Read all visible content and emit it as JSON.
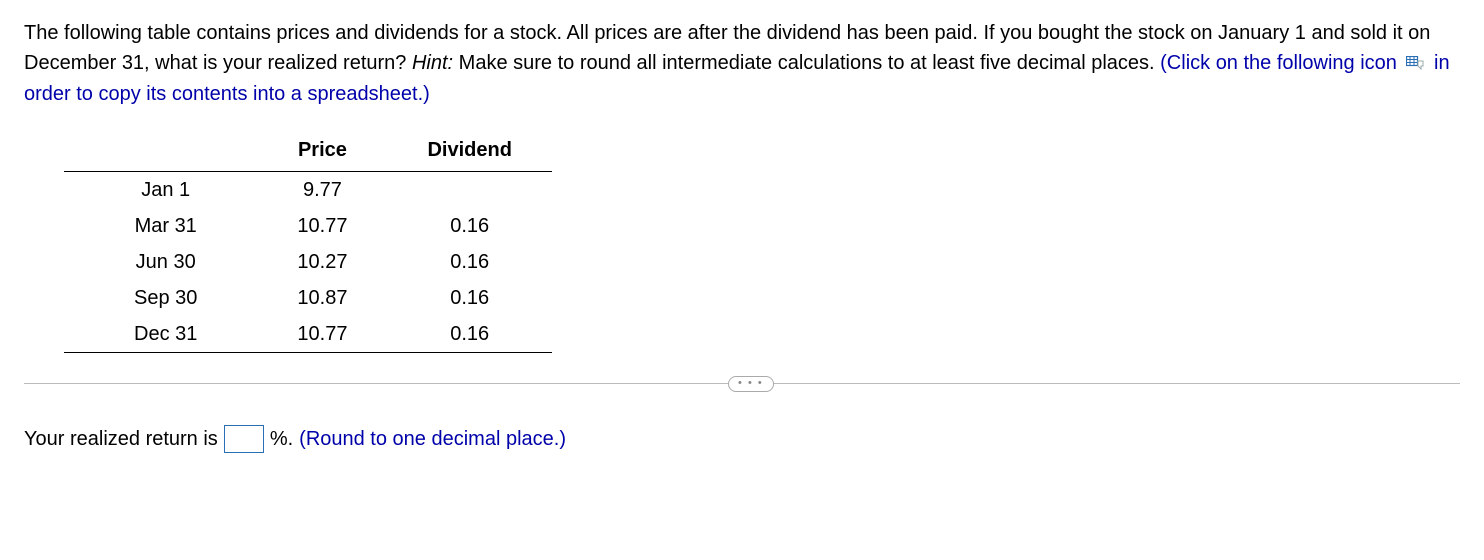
{
  "question": {
    "intro": "The following table contains prices and dividends for a stock. All prices are after the dividend has been paid. If you bought the stock on January 1 and sold it on December 31, what is your realized return?  ",
    "hint_label": "Hint:",
    "hint_text": " Make sure to round all intermediate calculations to at least five decimal places.",
    "copy_instruction_pre": "  (Click on the following icon ",
    "copy_instruction_post": "  in order to copy its contents into a spreadsheet.)"
  },
  "table": {
    "headers": {
      "col1": "",
      "col2": "Price",
      "col3": "Dividend"
    },
    "rows": [
      {
        "date": "Jan 1",
        "price": "9.77",
        "dividend": ""
      },
      {
        "date": "Mar 31",
        "price": "10.77",
        "dividend": "0.16"
      },
      {
        "date": "Jun 30",
        "price": "10.27",
        "dividend": "0.16"
      },
      {
        "date": "Sep 30",
        "price": "10.87",
        "dividend": "0.16"
      },
      {
        "date": "Dec 31",
        "price": "10.77",
        "dividend": "0.16"
      }
    ]
  },
  "expand_label": "• • •",
  "answer": {
    "prefix": "Your realized return is",
    "value": "",
    "suffix": "%.",
    "note": "  (Round to one decimal place.)"
  }
}
